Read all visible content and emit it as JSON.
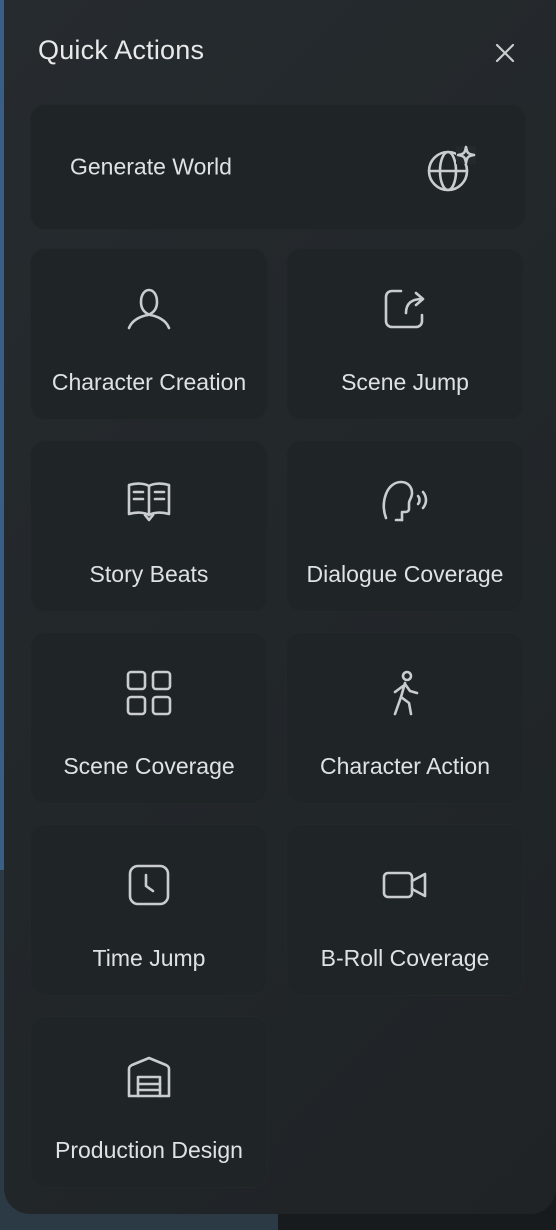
{
  "panel": {
    "title": "Quick Actions",
    "close_icon": "close-icon"
  },
  "featured": {
    "label": "Generate World",
    "icon": "globe-sparkle-icon"
  },
  "actions": [
    {
      "label": "Character Creation",
      "icon": "person-icon"
    },
    {
      "label": "Scene Jump",
      "icon": "share-arrow-icon"
    },
    {
      "label": "Story Beats",
      "icon": "book-icon"
    },
    {
      "label": "Dialogue Coverage",
      "icon": "speaking-head-icon"
    },
    {
      "label": "Scene Coverage",
      "icon": "grid-icon"
    },
    {
      "label": "Character Action",
      "icon": "walking-person-icon"
    },
    {
      "label": "Time Jump",
      "icon": "clock-icon"
    },
    {
      "label": "B-Roll Coverage",
      "icon": "video-camera-icon"
    },
    {
      "label": "Production Design",
      "icon": "warehouse-icon"
    }
  ],
  "colors": {
    "panel_bg": "#24292c",
    "card_bg": "#1f2427",
    "text": "#dfe2e4",
    "icon": "#c9cdd0"
  }
}
